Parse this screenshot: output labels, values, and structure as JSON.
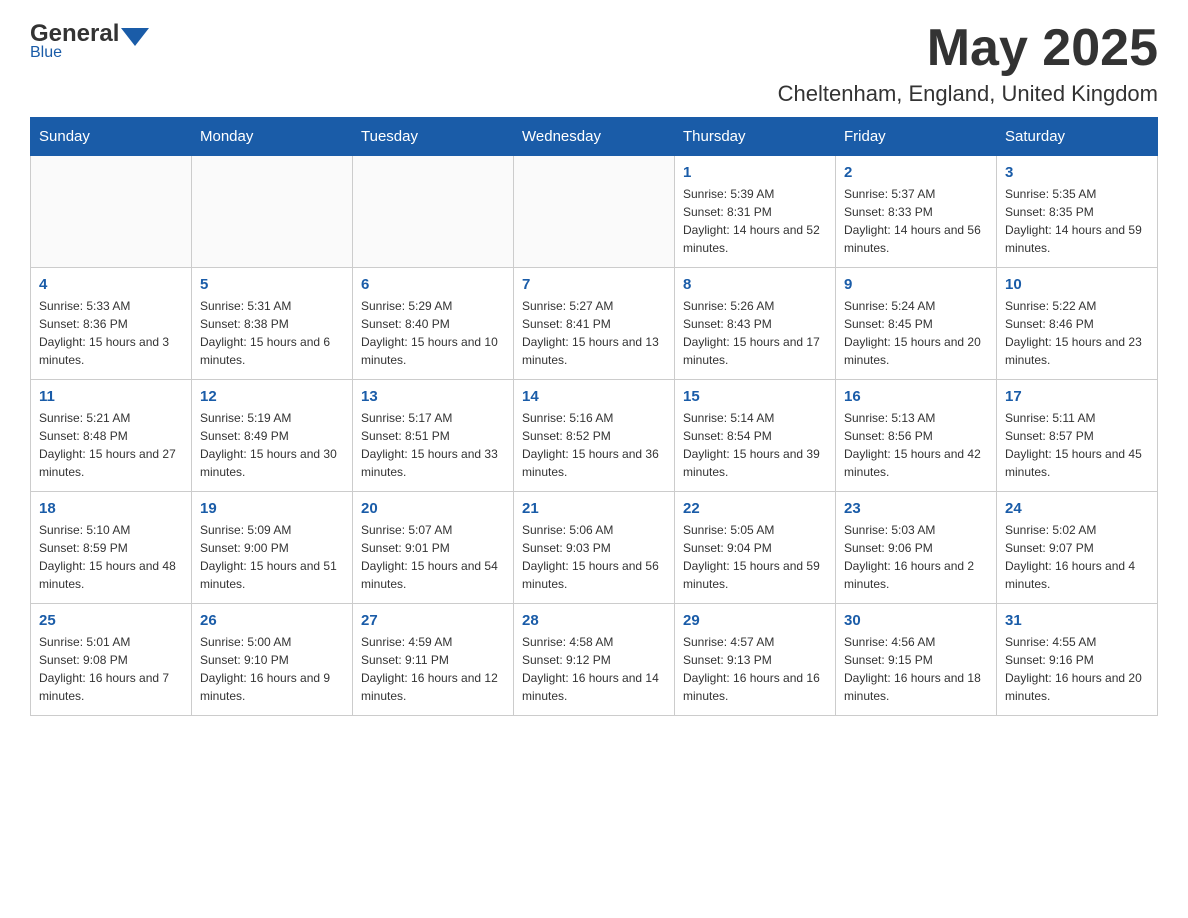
{
  "header": {
    "logo_general": "General",
    "logo_blue": "Blue",
    "month_title": "May 2025",
    "location": "Cheltenham, England, United Kingdom"
  },
  "days_of_week": [
    "Sunday",
    "Monday",
    "Tuesday",
    "Wednesday",
    "Thursday",
    "Friday",
    "Saturday"
  ],
  "weeks": [
    [
      {
        "day": "",
        "sunrise": "",
        "sunset": "",
        "daylight": ""
      },
      {
        "day": "",
        "sunrise": "",
        "sunset": "",
        "daylight": ""
      },
      {
        "day": "",
        "sunrise": "",
        "sunset": "",
        "daylight": ""
      },
      {
        "day": "",
        "sunrise": "",
        "sunset": "",
        "daylight": ""
      },
      {
        "day": "1",
        "sunrise": "Sunrise: 5:39 AM",
        "sunset": "Sunset: 8:31 PM",
        "daylight": "Daylight: 14 hours and 52 minutes."
      },
      {
        "day": "2",
        "sunrise": "Sunrise: 5:37 AM",
        "sunset": "Sunset: 8:33 PM",
        "daylight": "Daylight: 14 hours and 56 minutes."
      },
      {
        "day": "3",
        "sunrise": "Sunrise: 5:35 AM",
        "sunset": "Sunset: 8:35 PM",
        "daylight": "Daylight: 14 hours and 59 minutes."
      }
    ],
    [
      {
        "day": "4",
        "sunrise": "Sunrise: 5:33 AM",
        "sunset": "Sunset: 8:36 PM",
        "daylight": "Daylight: 15 hours and 3 minutes."
      },
      {
        "day": "5",
        "sunrise": "Sunrise: 5:31 AM",
        "sunset": "Sunset: 8:38 PM",
        "daylight": "Daylight: 15 hours and 6 minutes."
      },
      {
        "day": "6",
        "sunrise": "Sunrise: 5:29 AM",
        "sunset": "Sunset: 8:40 PM",
        "daylight": "Daylight: 15 hours and 10 minutes."
      },
      {
        "day": "7",
        "sunrise": "Sunrise: 5:27 AM",
        "sunset": "Sunset: 8:41 PM",
        "daylight": "Daylight: 15 hours and 13 minutes."
      },
      {
        "day": "8",
        "sunrise": "Sunrise: 5:26 AM",
        "sunset": "Sunset: 8:43 PM",
        "daylight": "Daylight: 15 hours and 17 minutes."
      },
      {
        "day": "9",
        "sunrise": "Sunrise: 5:24 AM",
        "sunset": "Sunset: 8:45 PM",
        "daylight": "Daylight: 15 hours and 20 minutes."
      },
      {
        "day": "10",
        "sunrise": "Sunrise: 5:22 AM",
        "sunset": "Sunset: 8:46 PM",
        "daylight": "Daylight: 15 hours and 23 minutes."
      }
    ],
    [
      {
        "day": "11",
        "sunrise": "Sunrise: 5:21 AM",
        "sunset": "Sunset: 8:48 PM",
        "daylight": "Daylight: 15 hours and 27 minutes."
      },
      {
        "day": "12",
        "sunrise": "Sunrise: 5:19 AM",
        "sunset": "Sunset: 8:49 PM",
        "daylight": "Daylight: 15 hours and 30 minutes."
      },
      {
        "day": "13",
        "sunrise": "Sunrise: 5:17 AM",
        "sunset": "Sunset: 8:51 PM",
        "daylight": "Daylight: 15 hours and 33 minutes."
      },
      {
        "day": "14",
        "sunrise": "Sunrise: 5:16 AM",
        "sunset": "Sunset: 8:52 PM",
        "daylight": "Daylight: 15 hours and 36 minutes."
      },
      {
        "day": "15",
        "sunrise": "Sunrise: 5:14 AM",
        "sunset": "Sunset: 8:54 PM",
        "daylight": "Daylight: 15 hours and 39 minutes."
      },
      {
        "day": "16",
        "sunrise": "Sunrise: 5:13 AM",
        "sunset": "Sunset: 8:56 PM",
        "daylight": "Daylight: 15 hours and 42 minutes."
      },
      {
        "day": "17",
        "sunrise": "Sunrise: 5:11 AM",
        "sunset": "Sunset: 8:57 PM",
        "daylight": "Daylight: 15 hours and 45 minutes."
      }
    ],
    [
      {
        "day": "18",
        "sunrise": "Sunrise: 5:10 AM",
        "sunset": "Sunset: 8:59 PM",
        "daylight": "Daylight: 15 hours and 48 minutes."
      },
      {
        "day": "19",
        "sunrise": "Sunrise: 5:09 AM",
        "sunset": "Sunset: 9:00 PM",
        "daylight": "Daylight: 15 hours and 51 minutes."
      },
      {
        "day": "20",
        "sunrise": "Sunrise: 5:07 AM",
        "sunset": "Sunset: 9:01 PM",
        "daylight": "Daylight: 15 hours and 54 minutes."
      },
      {
        "day": "21",
        "sunrise": "Sunrise: 5:06 AM",
        "sunset": "Sunset: 9:03 PM",
        "daylight": "Daylight: 15 hours and 56 minutes."
      },
      {
        "day": "22",
        "sunrise": "Sunrise: 5:05 AM",
        "sunset": "Sunset: 9:04 PM",
        "daylight": "Daylight: 15 hours and 59 minutes."
      },
      {
        "day": "23",
        "sunrise": "Sunrise: 5:03 AM",
        "sunset": "Sunset: 9:06 PM",
        "daylight": "Daylight: 16 hours and 2 minutes."
      },
      {
        "day": "24",
        "sunrise": "Sunrise: 5:02 AM",
        "sunset": "Sunset: 9:07 PM",
        "daylight": "Daylight: 16 hours and 4 minutes."
      }
    ],
    [
      {
        "day": "25",
        "sunrise": "Sunrise: 5:01 AM",
        "sunset": "Sunset: 9:08 PM",
        "daylight": "Daylight: 16 hours and 7 minutes."
      },
      {
        "day": "26",
        "sunrise": "Sunrise: 5:00 AM",
        "sunset": "Sunset: 9:10 PM",
        "daylight": "Daylight: 16 hours and 9 minutes."
      },
      {
        "day": "27",
        "sunrise": "Sunrise: 4:59 AM",
        "sunset": "Sunset: 9:11 PM",
        "daylight": "Daylight: 16 hours and 12 minutes."
      },
      {
        "day": "28",
        "sunrise": "Sunrise: 4:58 AM",
        "sunset": "Sunset: 9:12 PM",
        "daylight": "Daylight: 16 hours and 14 minutes."
      },
      {
        "day": "29",
        "sunrise": "Sunrise: 4:57 AM",
        "sunset": "Sunset: 9:13 PM",
        "daylight": "Daylight: 16 hours and 16 minutes."
      },
      {
        "day": "30",
        "sunrise": "Sunrise: 4:56 AM",
        "sunset": "Sunset: 9:15 PM",
        "daylight": "Daylight: 16 hours and 18 minutes."
      },
      {
        "day": "31",
        "sunrise": "Sunrise: 4:55 AM",
        "sunset": "Sunset: 9:16 PM",
        "daylight": "Daylight: 16 hours and 20 minutes."
      }
    ]
  ]
}
